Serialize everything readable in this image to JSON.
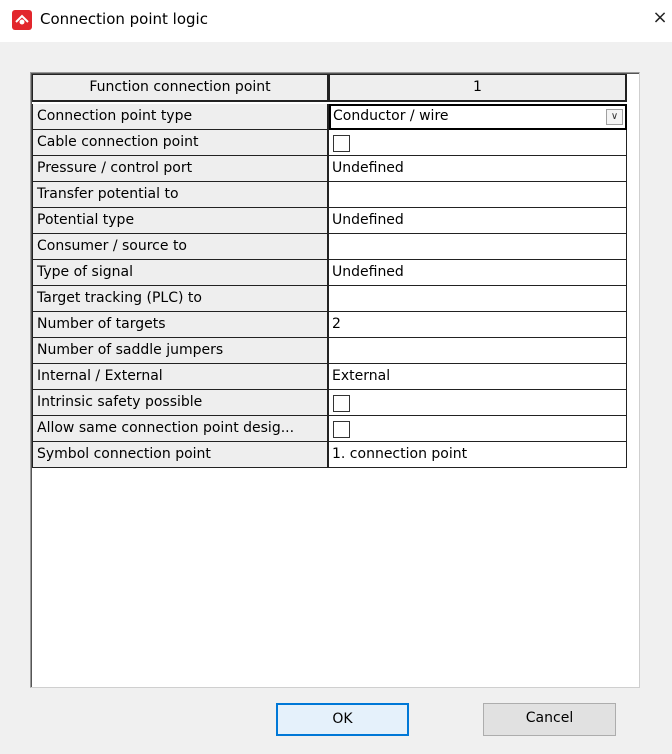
{
  "window": {
    "title": "Connection point logic",
    "close_glyph": "×",
    "icon": "eplan-app-icon",
    "icon_color": "#e2262c"
  },
  "grid": {
    "header": {
      "label": "Function connection point",
      "value": "1"
    },
    "rows": [
      {
        "label": "Connection point type",
        "value": "Conductor / wire",
        "type": "dropdown"
      },
      {
        "label": "Cable connection point",
        "value": "",
        "type": "checkbox",
        "checked": false
      },
      {
        "label": "Pressure / control port",
        "value": "Undefined",
        "type": "text"
      },
      {
        "label": "Transfer potential to",
        "value": "",
        "type": "text"
      },
      {
        "label": "Potential type",
        "value": "Undefined",
        "type": "text"
      },
      {
        "label": "Consumer / source to",
        "value": "",
        "type": "text"
      },
      {
        "label": "Type of signal",
        "value": "Undefined",
        "type": "text"
      },
      {
        "label": "Target tracking (PLC) to",
        "value": "",
        "type": "text"
      },
      {
        "label": "Number of targets",
        "value": "2",
        "type": "text"
      },
      {
        "label": "Number of saddle jumpers",
        "value": "",
        "type": "text"
      },
      {
        "label": "Internal / External",
        "value": "External",
        "type": "text"
      },
      {
        "label": "Intrinsic safety possible",
        "value": "",
        "type": "checkbox",
        "checked": false
      },
      {
        "label": "Allow same connection point desig...",
        "value": "",
        "type": "checkbox",
        "checked": false
      },
      {
        "label": "Symbol connection point",
        "value": "1. connection point",
        "type": "text"
      }
    ]
  },
  "buttons": {
    "ok": "OK",
    "cancel": "Cancel"
  }
}
